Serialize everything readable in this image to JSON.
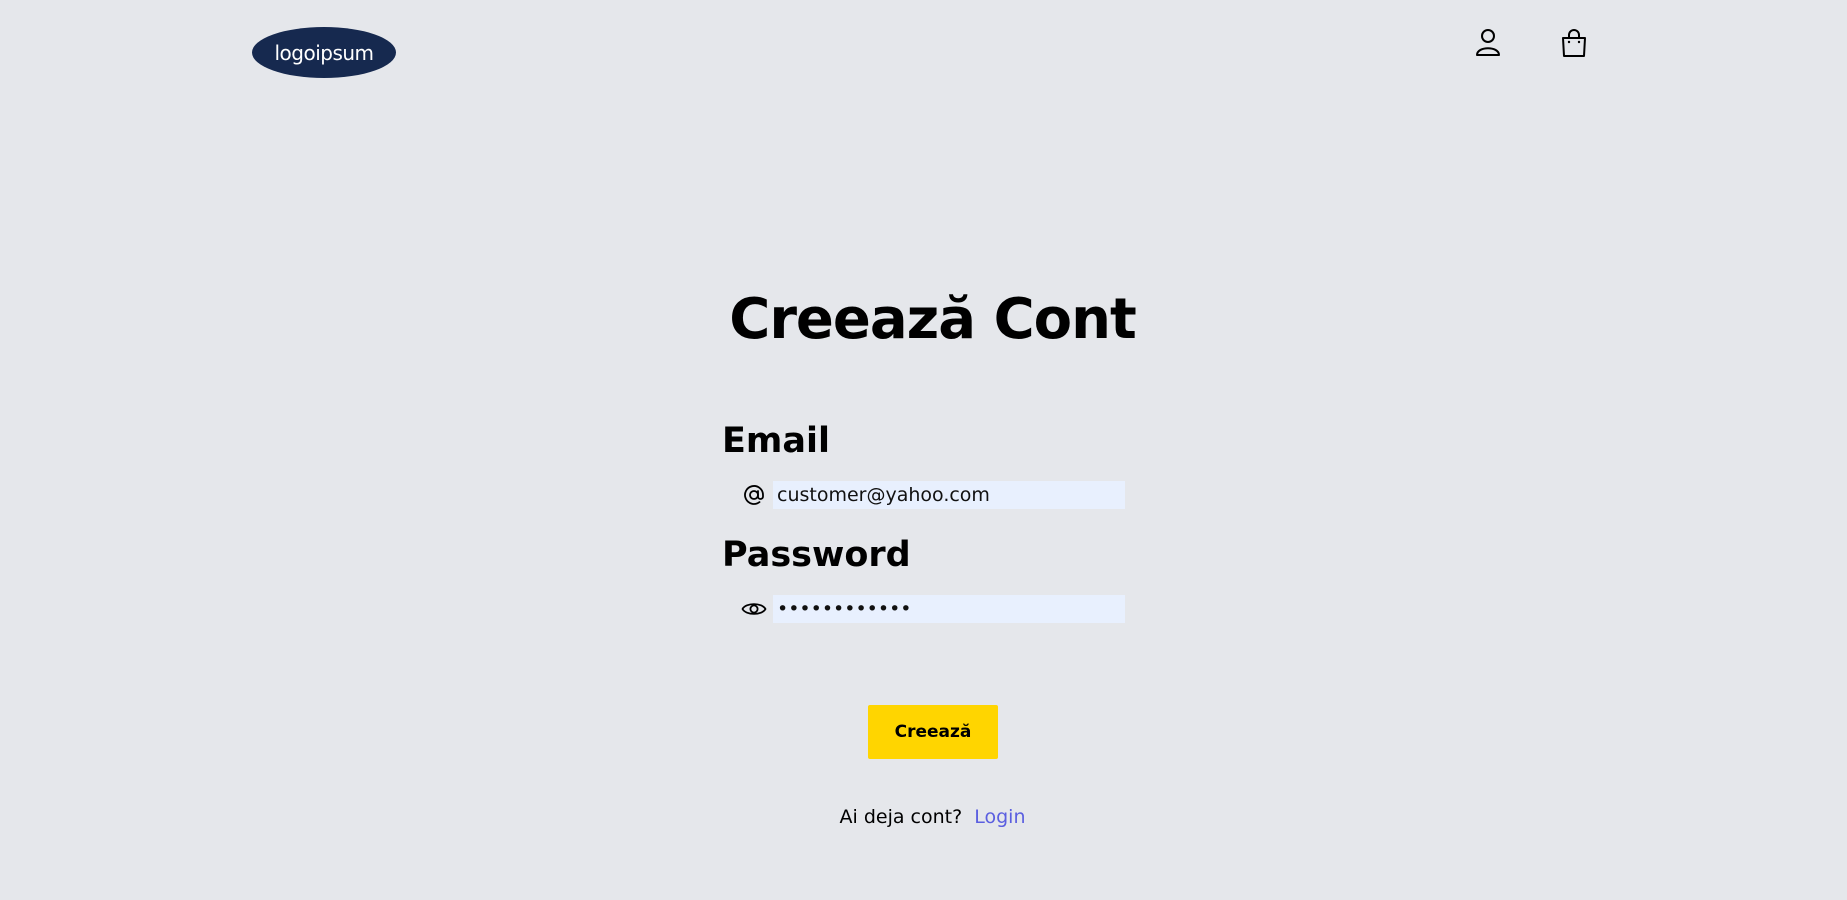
{
  "header": {
    "logo_text": "logoipsum",
    "user_icon": "user-icon",
    "cart_icon": "shopping-bag-icon"
  },
  "form": {
    "title": "Creează Cont",
    "email_label": "Email",
    "email_icon": "at-sign-icon",
    "email_value": "customer@yahoo.com",
    "password_label": "Password",
    "password_icon": "eye-icon",
    "password_value": "••••••••••••",
    "submit_label": "Creează"
  },
  "footer": {
    "prompt_text": "Ai deja cont?",
    "login_link": "Login"
  },
  "colors": {
    "background": "#e5e7eb",
    "logo_bg": "#16294f",
    "button_bg": "#ffd500",
    "link": "#5b5fe0",
    "input_bg": "#e8f0fe"
  }
}
